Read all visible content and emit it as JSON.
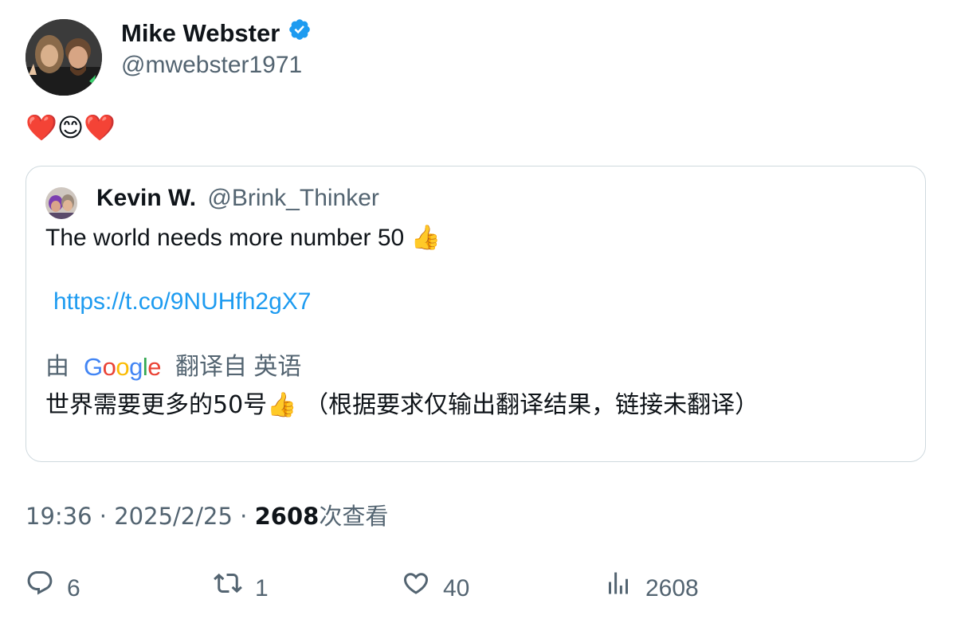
{
  "author": {
    "name": "Mike Webster",
    "handle": "@mwebster1971",
    "verified_icon": "verified-badge-icon"
  },
  "tweet": {
    "text": "❤️😊❤️"
  },
  "quote": {
    "name": "Kevin W.",
    "handle": "@Brink_Thinker",
    "text": "The world needs more number 50 👍",
    "link": "https://t.co/9NUHfh2gX7",
    "translation": {
      "prefix": "由",
      "provider_letters": [
        "G",
        "o",
        "o",
        "g",
        "l",
        "e"
      ],
      "suffix": "翻译自 英语",
      "text": "世界需要更多的50号👍 （根据要求仅输出翻译结果，链接未翻译）"
    }
  },
  "meta": {
    "time": "19:36",
    "sep1": " · ",
    "date": "2025/2/25",
    "sep2": " · ",
    "views_count": "2608",
    "views_suffix": "次查看"
  },
  "actions": {
    "reply_count": "6",
    "retweet_count": "1",
    "like_count": "40",
    "views_count": "2608"
  },
  "colors": {
    "accent": "#1d9bf0",
    "secondary_text": "#536471",
    "border": "#cfd9de",
    "google_blue": "#4285F4",
    "google_red": "#EA4335",
    "google_yellow": "#FBBC05",
    "google_green": "#34A853"
  }
}
